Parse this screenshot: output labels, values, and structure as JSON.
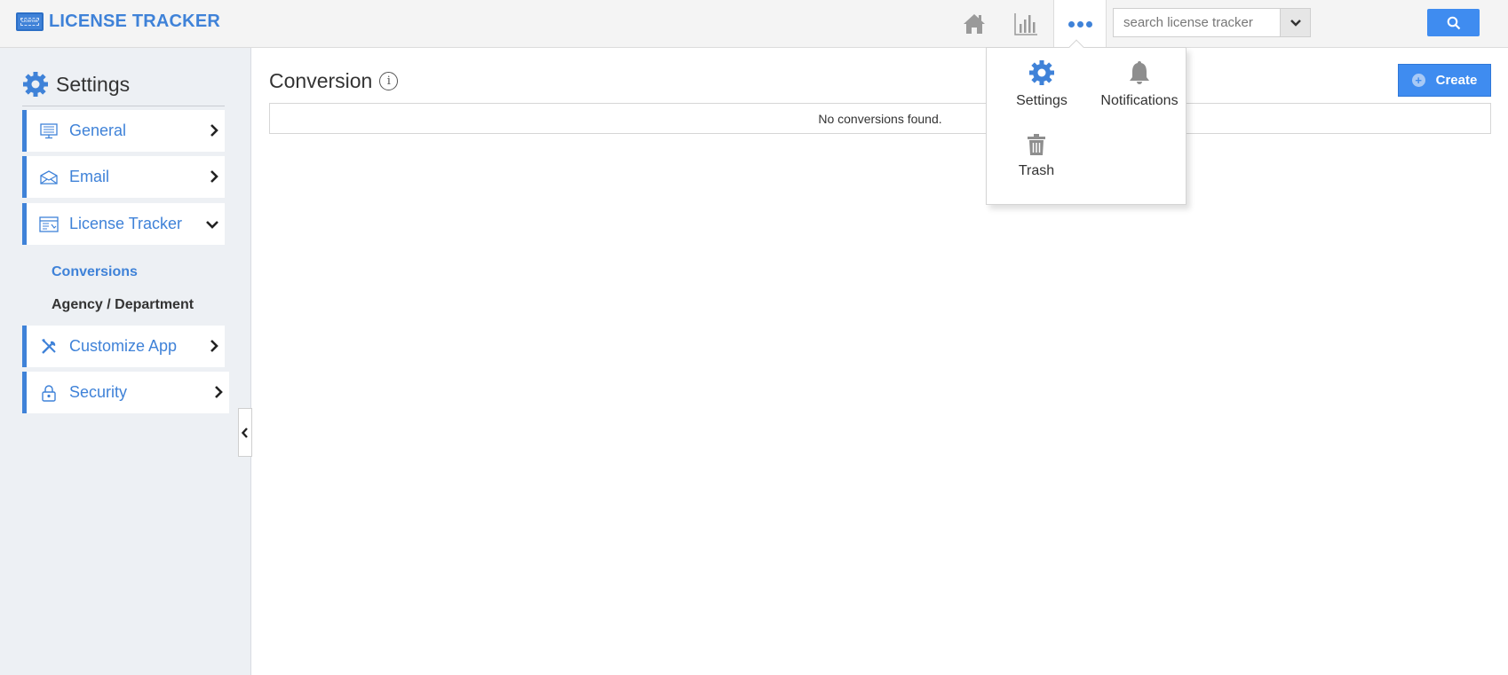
{
  "header": {
    "app_title": "LICENSE TRACKER",
    "logo_text": "License",
    "search_placeholder": "search license tracker",
    "nav_icons": [
      "home-icon",
      "chart-icon",
      "more-icon"
    ]
  },
  "sidebar": {
    "title": "Settings",
    "items": [
      {
        "label": "General",
        "icon": "monitor-icon",
        "expanded": false
      },
      {
        "label": "Email",
        "icon": "envelope-icon",
        "expanded": false
      },
      {
        "label": "License Tracker",
        "icon": "app-window-icon",
        "expanded": true
      },
      {
        "label": "Customize App",
        "icon": "tools-icon",
        "expanded": false
      },
      {
        "label": "Security",
        "icon": "lock-icon",
        "expanded": false
      }
    ],
    "subitems": [
      {
        "label": "Conversions",
        "active": true
      },
      {
        "label": "Agency / Department",
        "active": false
      }
    ]
  },
  "main": {
    "title": "Conversion",
    "create_label": "Create",
    "empty_message": "No conversions found."
  },
  "popup": {
    "items": [
      {
        "label": "Settings",
        "icon": "gear-icon"
      },
      {
        "label": "Notifications",
        "icon": "bell-icon"
      },
      {
        "label": "Trash",
        "icon": "trash-icon"
      }
    ]
  },
  "colors": {
    "accent": "#3f82d8",
    "button": "#3f8cf0",
    "sidebar_bg": "#edf0f4",
    "topbar_bg": "#f4f4f4"
  }
}
